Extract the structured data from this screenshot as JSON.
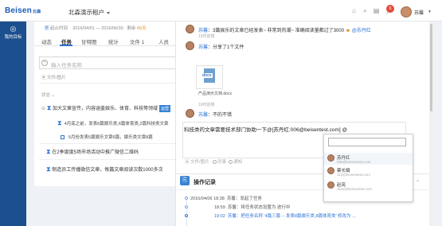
{
  "header": {
    "logo_text": "Beisen",
    "logo_sub": "北森",
    "company": "北森演示租户",
    "badge_count": "6",
    "user_name": "苏馨"
  },
  "sidebar": {
    "item_label": "我的目标"
  },
  "left": {
    "info_line_1": "起止时间",
    "info_line_2": "2016/04/01 — 2016/06/30",
    "info_line_3": "剩余",
    "days_left": "66",
    "days_unit": "天",
    "tabs": [
      "动态",
      "任务",
      "甘特图",
      "统计",
      "文件 1",
      "人员"
    ],
    "search_placeholder": "输入任务名称",
    "file_label": "文件/图片",
    "status_filter": "状态",
    "tasks": [
      {
        "title": "加大文章宣传，内容涵盖娱乐、体育、科技等领域",
        "tag": "运营"
      },
      {
        "title": "在2季度度5场市场活动中推广微信二维码"
      },
      {
        "title": "制造员工传播微信文章，每篇文章阅读次数1000多次"
      }
    ],
    "subtasks": [
      {
        "text": "4月底之前，发表6篇娱乐类,6篇体育类,2篇科技类文章"
      },
      {
        "text": "5月份发表5篇娱乐文章6篇，娱乐类文章8篇"
      }
    ]
  },
  "right": {
    "comments": [
      {
        "name": "苏馨",
        "text": "：3篇娱乐的文章已经发表~ 非常到热潮~ 准确阅读量都过了3000",
        "mention": "@苏丹红",
        "time": "15时前楼"
      },
      {
        "name": "苏馨",
        "text": "：分享了1个文件",
        "time": ""
      },
      {
        "name": "苏馨",
        "text": "：不的不错",
        "time": "19时前楼"
      }
    ],
    "file_tag": "docx",
    "file_name": "产品演示文档.docx",
    "composer_text": "科技类的文章需要技术部门协助一下@[苏丹红:006@beisentest.com] @",
    "composer_tools": {
      "attach": "文件/图片",
      "sync": "同事",
      "notify": "通知"
    },
    "mention_popup": {
      "people": [
        {
          "name": "苏丹红",
          "email": "006@beisentest.com"
        },
        {
          "name": "蔡长娟",
          "email": "112@beisentest.com"
        },
        {
          "name": "赵亮",
          "email": "zliao@beisentest.com"
        }
      ]
    },
    "oplog": {
      "title": "操作记录",
      "entries": [
        {
          "date": "2016/04/06",
          "time": "18:38",
          "text": "苏馨：发起了任务"
        },
        {
          "date": "",
          "time": "18:59",
          "text": "苏馨：将任务状态设置为 进行中"
        },
        {
          "date": "",
          "time": "19:02",
          "text": "苏馨：把任务名称 ‘4篇三篇 -- 发表8篇娱乐类,8篇体育类’ 修改为 ..."
        }
      ]
    }
  }
}
